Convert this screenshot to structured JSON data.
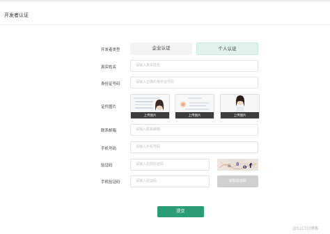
{
  "header": {
    "title": "开发者认证"
  },
  "form": {
    "type": {
      "label": "开发者类型",
      "options": [
        "企业认证",
        "个人认证"
      ],
      "selected": "个人认证"
    },
    "real_name": {
      "label": "真实姓名",
      "placeholder": "请输入真实姓名"
    },
    "id_number": {
      "label": "身份证号码",
      "placeholder": "请输入正确的身份证号码"
    },
    "id_photos": {
      "label": "证件图片",
      "upload_label": "上传图片"
    },
    "email": {
      "label": "联系邮箱",
      "placeholder": "请输入联系邮箱"
    },
    "phone": {
      "label": "手机号码",
      "placeholder": "请输入手机号码"
    },
    "captcha": {
      "label": "验证码",
      "placeholder": "请输入右侧验证码"
    },
    "sms_code": {
      "label": "手机验证码",
      "placeholder": "请输入验证码",
      "button": "获取验证码"
    },
    "submit": "提交"
  },
  "watermark": "@51CTO博客",
  "colors": {
    "accent": "#2a9d76",
    "selected_bg": "#dff3ec",
    "upload_bar": "#3d3d3d"
  }
}
